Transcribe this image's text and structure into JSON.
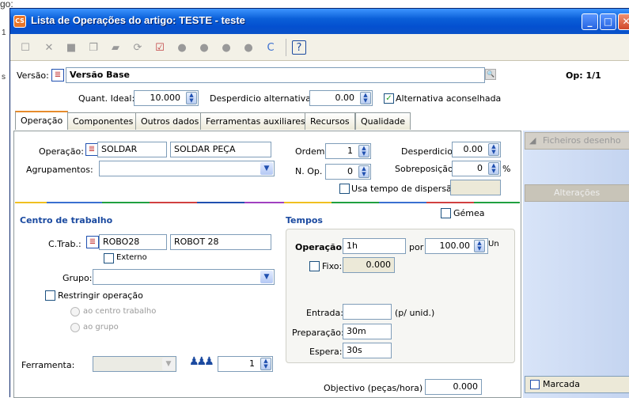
{
  "background": {
    "fragment_top": "go:",
    "fragment_left_1": "1",
    "fragment_left_2": "s"
  },
  "window": {
    "title": "Lista de Operações do artigo:  TESTE - teste",
    "icon_text": "CS"
  },
  "header": {
    "versao_label": "Versão:",
    "versao_value": "Versão Base",
    "op_counter": "Op: 1/1",
    "quant_ideal_label": "Quant. Ideal:",
    "quant_ideal_value": "10.000",
    "desperdicio_alt_label": "Desperdicio alternativa:",
    "desperdicio_alt_value": "0.00",
    "alternativa_label": "Alternativa aconselhada"
  },
  "tabs": [
    {
      "label": "Operação"
    },
    {
      "label": "Componentes"
    },
    {
      "label": "Outros dados"
    },
    {
      "label": "Ferramentas auxiliares"
    },
    {
      "label": "Recursos"
    },
    {
      "label": "Qualidade"
    }
  ],
  "operacao": {
    "operacao_label": "Operação:",
    "operacao_code": "SOLDAR",
    "operacao_desc": "SOLDAR PEÇA",
    "agrupamentos_label": "Agrupamentos:",
    "ordem_label": "Ordem:",
    "ordem_value": "1",
    "nop_label": "N. Op.",
    "nop_value": "0",
    "desperdicio_label": "Desperdicio:",
    "desperdicio_value": "0.00",
    "sobreposicao_label": "Sobreposição:",
    "sobreposicao_value": "0",
    "percent": "%",
    "usa_tempo_label": "Usa tempo de dispersão:"
  },
  "centro": {
    "title": "Centro de trabalho",
    "ctrab_label": "C.Trab.:",
    "ctrab_code": "ROBO28",
    "ctrab_desc": "ROBOT 28",
    "externo_label": "Externo",
    "grupo_label": "Grupo:",
    "restringir_label": "Restringir operação",
    "radio_1": "ao centro trabalho",
    "radio_2": "ao grupo",
    "ferramenta_label": "Ferramenta:",
    "ferramenta_qty": "1"
  },
  "tempos": {
    "title": "Tempos",
    "gemea_label": "Gémea",
    "operacao_label": "Operação:",
    "operacao_value": "1h",
    "por_label": "por",
    "por_value": "100.00",
    "un_label": "Un",
    "fixo_label": "Fixo:",
    "fixo_value": "0.000",
    "entrada_label": "Entrada:",
    "entrada_value": "",
    "punid_label": "(p/ unid.)",
    "preparacao_label": "Preparação:",
    "preparacao_value": "30m",
    "espera_label": "Espera:",
    "espera_value": "30s",
    "objectivo_label": "Objectivo (peças/hora)",
    "objectivo_value": "0.000"
  },
  "side": {
    "ficheiros_label": "Ficheiros desenho",
    "alteracoes_label": "Alterações",
    "marcada_label": "Marcada"
  }
}
